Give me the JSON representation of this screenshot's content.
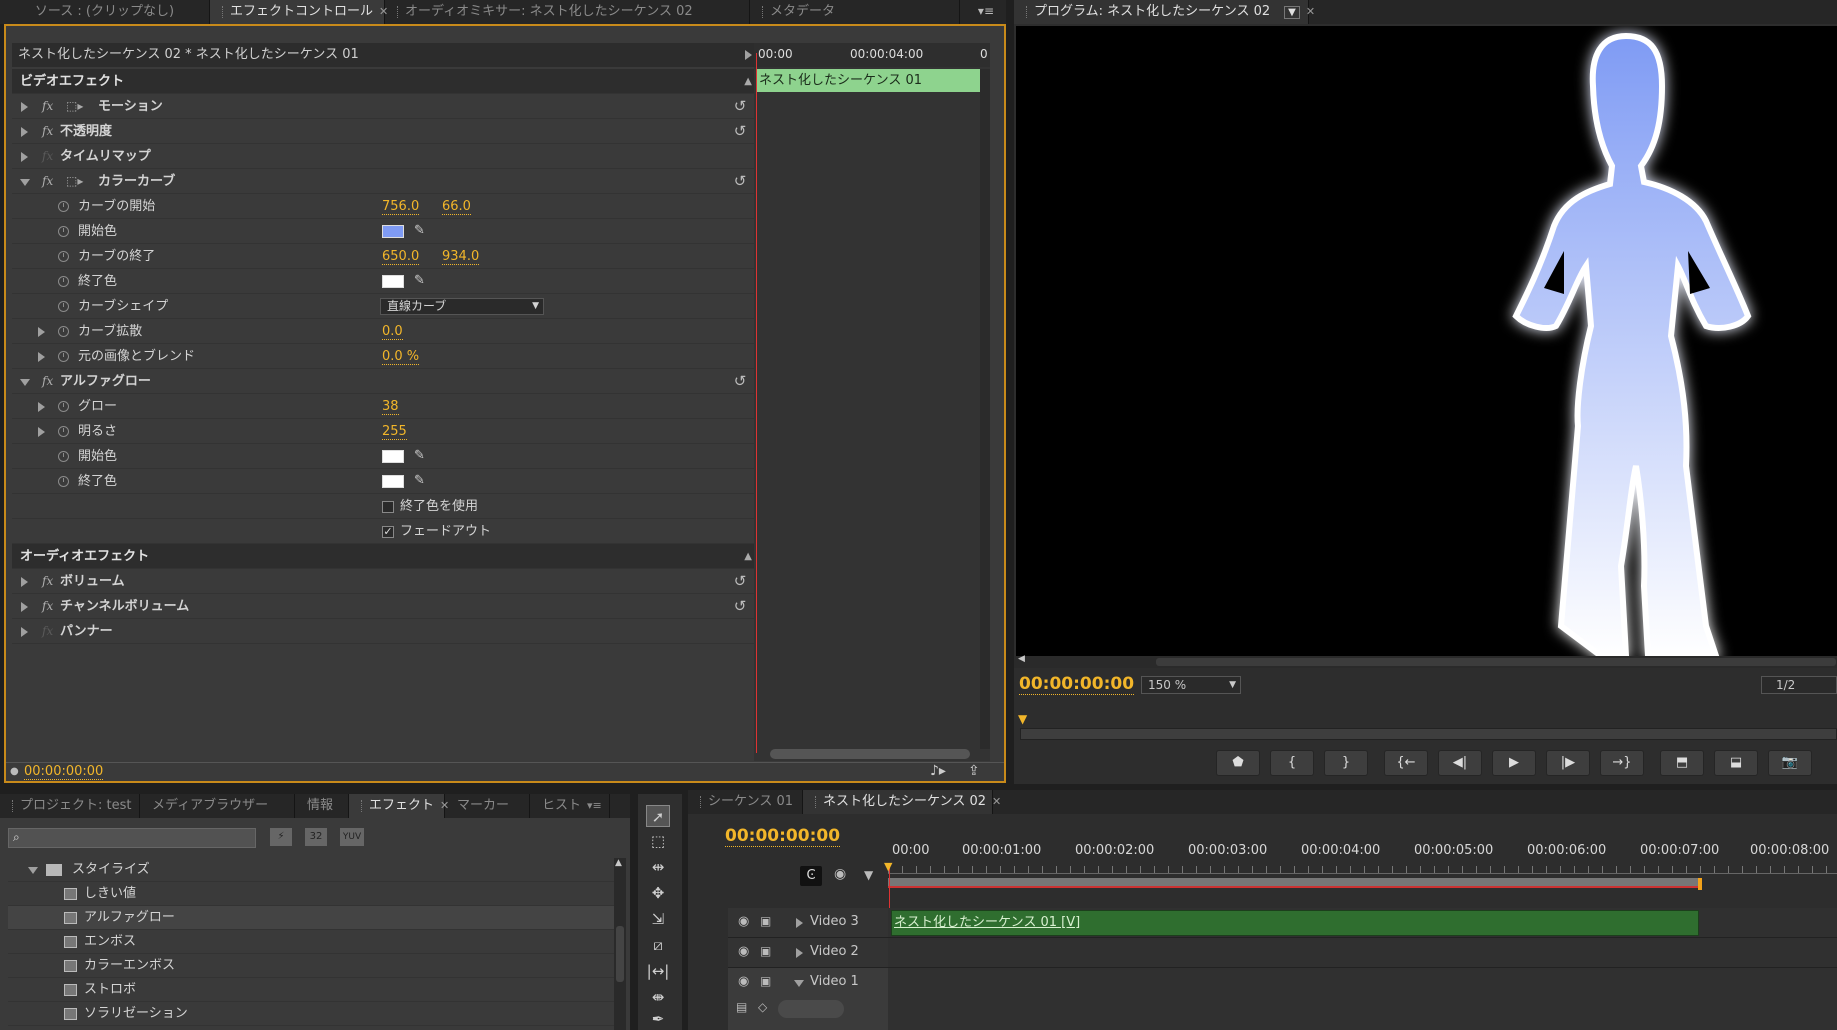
{
  "top_tabs": {
    "source": "ソース : (クリップなし)",
    "effect_controls": "エフェクトコントロール",
    "audio_mixer": "オーディオミキサー: ネスト化したシーケンス 02",
    "metadata": "メタデータ"
  },
  "program_tab": "プログラム: ネスト化したシーケンス 02",
  "ec": {
    "header": "ネスト化したシーケンス 02 * ネスト化したシーケンス 01",
    "mini_timeline": {
      "start": "00:00",
      "mid": "00:00:04:00",
      "end": "0",
      "clip": "ネスト化したシーケンス 01"
    },
    "video_effects": "ビデオエフェクト",
    "motion": "モーション",
    "opacity": "不透明度",
    "time_remap": "タイムリマップ",
    "color_curve": "カラーカーブ",
    "curve_start": {
      "label": "カーブの開始",
      "v1": "756.0",
      "v2": "66.0"
    },
    "start_color": {
      "label": "開始色",
      "color": "#7f9bf4"
    },
    "curve_end": {
      "label": "カーブの終了",
      "v1": "650.0",
      "v2": "934.0"
    },
    "end_color": {
      "label": "終了色",
      "color": "#ffffff"
    },
    "curve_shape": {
      "label": "カーブシェイプ",
      "value": "直線カーブ"
    },
    "curve_spread": {
      "label": "カーブ拡散",
      "value": "0.0"
    },
    "blend": {
      "label": "元の画像とブレンド",
      "value": "0.0 %"
    },
    "alpha_glow": "アルファグロー",
    "glow": {
      "label": "グロー",
      "value": "38"
    },
    "brightness": {
      "label": "明るさ",
      "value": "255"
    },
    "glow_start_color": {
      "label": "開始色",
      "color": "#ffffff"
    },
    "glow_end_color": {
      "label": "終了色",
      "color": "#ffffff"
    },
    "use_end_color": {
      "label": "終了色を使用",
      "checked": false
    },
    "fade_out": {
      "label": "フェードアウト",
      "checked": true
    },
    "audio_effects": "オーディオエフェクト",
    "volume": "ボリューム",
    "channel_volume": "チャンネルボリューム",
    "panner": "パンナー",
    "timecode": "00:00:00:00"
  },
  "program": {
    "timecode": "00:00:00:00",
    "zoom": "150 %",
    "resolution": "1/2"
  },
  "bottom_tabs": {
    "project": "プロジェクト: test",
    "media_browser": "メディアブラウザー",
    "info": "情報",
    "effects": "エフェクト",
    "markers": "マーカー",
    "history": "ヒスト"
  },
  "effects_panel": {
    "folder": "スタイライズ",
    "items": [
      "しきい値",
      "アルファグロー",
      "エンボス",
      "カラーエンボス",
      "ストロボ",
      "ソラリゼーション"
    ],
    "icon_32": "32",
    "icon_yuv": "YUV"
  },
  "timeline": {
    "tab1": "シーケンス 01",
    "tab2": "ネスト化したシーケンス 02",
    "timecode": "00:00:00:00",
    "ruler": [
      "00:00",
      "00:00:01:00",
      "00:00:02:00",
      "00:00:03:00",
      "00:00:04:00",
      "00:00:05:00",
      "00:00:06:00",
      "00:00:07:00",
      "00:00:08:00"
    ],
    "tracks": [
      "Video 3",
      "Video 2",
      "Video 1"
    ],
    "clip": "ネスト化したシーケンス 01 [V]"
  },
  "colors": {
    "accent": "#f2b62a",
    "clip_green": "#2f6e2f",
    "mini_clip": "#8ed38e",
    "panel_border": "#c88a1a"
  }
}
